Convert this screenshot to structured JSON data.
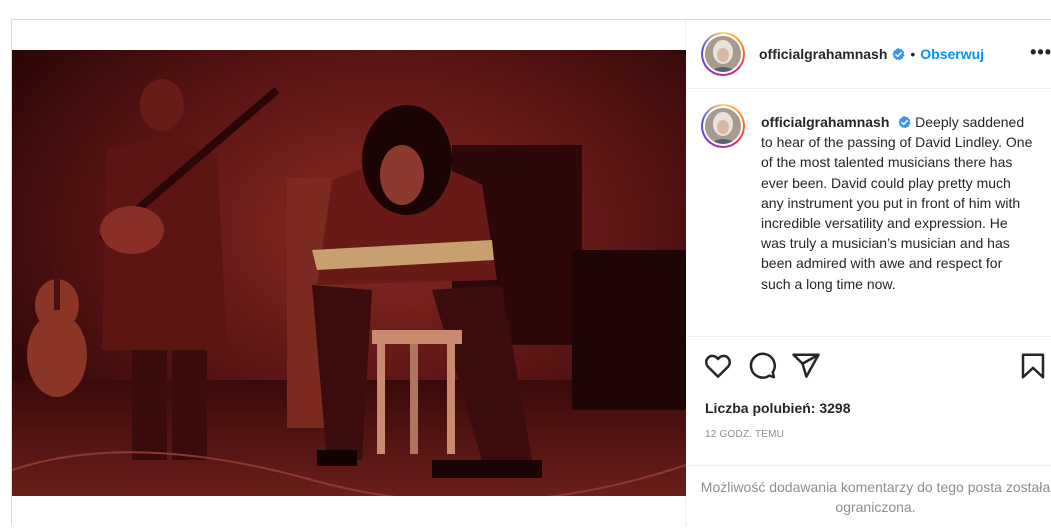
{
  "post": {
    "username": "officialgrahamnash",
    "separator": "•",
    "follow_label": "Obserwuj",
    "more_label": "•••",
    "caption": "Deeply saddened to hear of the passing of David Lindley. One of the most talented musicians there has ever been. David could play pretty much any instrument you put in front of him with incredible versatility and expression. He was truly a musician’s musician and has been admired with awe and respect for such a long time now.",
    "likes": "Liczba polubień: 3298",
    "timestamp": "12 godz. temu",
    "comments_disabled": "Możliwość dodawania komentarzy do tego posta została ograniczona."
  },
  "icons": {
    "verified": "verified-badge-icon",
    "like": "heart-icon",
    "comment": "comment-icon",
    "share": "paper-plane-icon",
    "save": "bookmark-icon"
  },
  "colors": {
    "accent": "#0095f6",
    "verified": "#3897f0",
    "photo_tint": "#7a1a1a"
  }
}
